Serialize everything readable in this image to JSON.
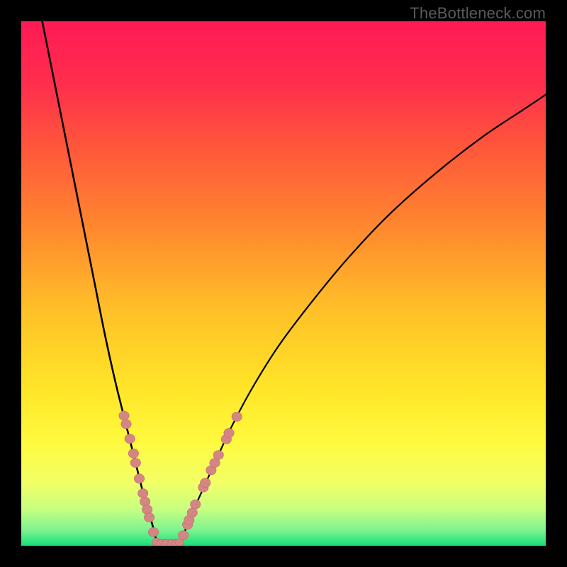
{
  "watermark": "TheBottleneck.com",
  "colors": {
    "background_black": "#000000",
    "gradient_stops": [
      {
        "offset": 0.0,
        "color": "#ff1a55"
      },
      {
        "offset": 0.12,
        "color": "#ff2e4d"
      },
      {
        "offset": 0.25,
        "color": "#ff5a3a"
      },
      {
        "offset": 0.4,
        "color": "#ff8a2e"
      },
      {
        "offset": 0.55,
        "color": "#ffc028"
      },
      {
        "offset": 0.7,
        "color": "#ffe528"
      },
      {
        "offset": 0.8,
        "color": "#fff93e"
      },
      {
        "offset": 0.88,
        "color": "#f2ff66"
      },
      {
        "offset": 0.93,
        "color": "#c8ff80"
      },
      {
        "offset": 0.97,
        "color": "#7ef38f"
      },
      {
        "offset": 1.0,
        "color": "#17e07a"
      }
    ],
    "curve_stroke": "#000000",
    "marker_fill": "#d68585",
    "marker_stroke": "#b86e6e"
  },
  "chart_data": {
    "type": "line",
    "title": "",
    "xlabel": "",
    "ylabel": "",
    "xlim": [
      0,
      1
    ],
    "ylim": [
      0,
      1
    ],
    "series": [
      {
        "name": "left-curve",
        "x": [
          0.04,
          0.06,
          0.08,
          0.1,
          0.12,
          0.14,
          0.16,
          0.18,
          0.2,
          0.22,
          0.23,
          0.24,
          0.25,
          0.255,
          0.258,
          0.26
        ],
        "y": [
          1.0,
          0.9,
          0.8,
          0.7,
          0.6,
          0.5,
          0.4,
          0.31,
          0.23,
          0.15,
          0.11,
          0.075,
          0.04,
          0.02,
          0.008,
          0.0
        ]
      },
      {
        "name": "right-curve",
        "x": [
          0.3,
          0.305,
          0.312,
          0.325,
          0.345,
          0.37,
          0.4,
          0.44,
          0.49,
          0.55,
          0.62,
          0.7,
          0.79,
          0.88,
          0.955,
          1.0
        ],
        "y": [
          0.0,
          0.01,
          0.028,
          0.06,
          0.105,
          0.16,
          0.225,
          0.3,
          0.38,
          0.46,
          0.545,
          0.63,
          0.71,
          0.78,
          0.83,
          0.86
        ]
      }
    ],
    "floor_segment": {
      "x0": 0.26,
      "x1": 0.3,
      "y": 0.0
    },
    "markers_left": [
      {
        "x": 0.196,
        "y": 0.248
      },
      {
        "x": 0.2,
        "y": 0.232
      },
      {
        "x": 0.207,
        "y": 0.204
      },
      {
        "x": 0.214,
        "y": 0.176
      },
      {
        "x": 0.218,
        "y": 0.158
      },
      {
        "x": 0.225,
        "y": 0.128
      },
      {
        "x": 0.232,
        "y": 0.1
      },
      {
        "x": 0.236,
        "y": 0.084
      },
      {
        "x": 0.24,
        "y": 0.069
      },
      {
        "x": 0.244,
        "y": 0.054
      },
      {
        "x": 0.252,
        "y": 0.026
      }
    ],
    "markers_right": [
      {
        "x": 0.309,
        "y": 0.02
      },
      {
        "x": 0.317,
        "y": 0.04
      },
      {
        "x": 0.32,
        "y": 0.049
      },
      {
        "x": 0.326,
        "y": 0.063
      },
      {
        "x": 0.332,
        "y": 0.079
      },
      {
        "x": 0.347,
        "y": 0.111
      },
      {
        "x": 0.351,
        "y": 0.12
      },
      {
        "x": 0.362,
        "y": 0.144
      },
      {
        "x": 0.369,
        "y": 0.158
      },
      {
        "x": 0.376,
        "y": 0.173
      },
      {
        "x": 0.391,
        "y": 0.203
      },
      {
        "x": 0.396,
        "y": 0.215
      },
      {
        "x": 0.411,
        "y": 0.246
      }
    ],
    "markers_floor": [
      {
        "x": 0.258,
        "y": 0.003
      },
      {
        "x": 0.266,
        "y": 0.0
      },
      {
        "x": 0.276,
        "y": 0.0
      },
      {
        "x": 0.286,
        "y": 0.0
      },
      {
        "x": 0.296,
        "y": 0.0
      },
      {
        "x": 0.302,
        "y": 0.002
      }
    ]
  }
}
